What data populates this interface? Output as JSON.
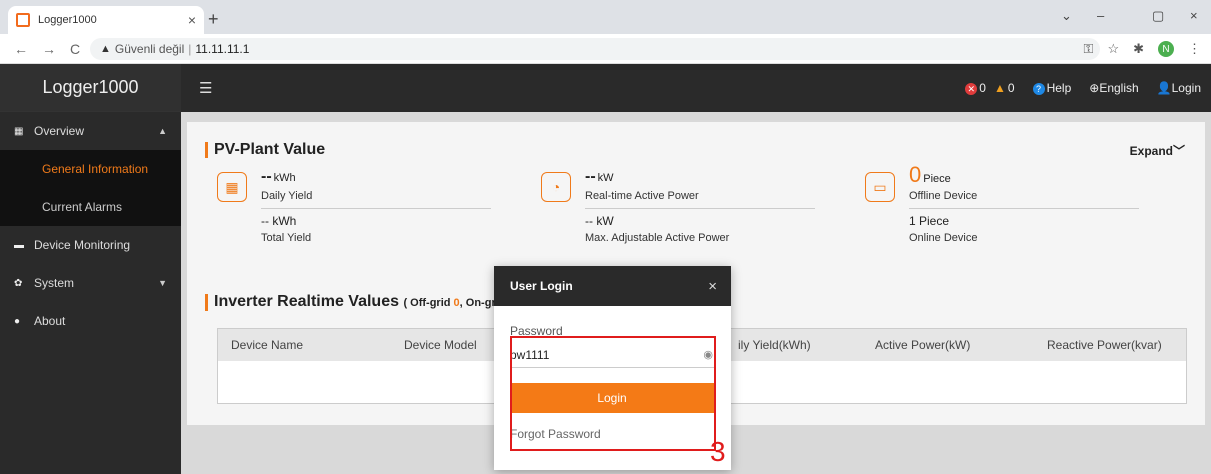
{
  "browser": {
    "tab_title": "Logger1000",
    "tab_close": "×",
    "new_tab": "+",
    "back": "←",
    "forward": "→",
    "reload": "C",
    "security_label": "Güvenli değil",
    "address": "11.11.11.1",
    "profile_initial": "N",
    "win_min": "–",
    "win_max": "▢",
    "win_close": "×",
    "tab_dropdown": "⌄"
  },
  "app": {
    "brand": "Logger1000",
    "header": {
      "error_count": "0",
      "warning_count": "0",
      "help": "Help",
      "language": "English",
      "login": "Login"
    },
    "sidebar": {
      "overview": "Overview",
      "general_information": "General Information",
      "current_alarms": "Current Alarms",
      "device_monitoring": "Device Monitoring",
      "system": "System",
      "about": "About"
    },
    "pv_plant": {
      "title": "PV-Plant Value",
      "expand": "Expand",
      "daily_yield_value": "--",
      "daily_yield_unit": "kWh",
      "daily_yield_label": "Daily Yield",
      "total_yield_value": "-- kWh",
      "total_yield_label": "Total Yield",
      "active_power_value": "--",
      "active_power_unit": "kW",
      "active_power_label": "Real-time Active Power",
      "max_power_value": "-- kW",
      "max_power_label": "Max. Adjustable Active Power",
      "offline_value": "0",
      "offline_unit": "Piece",
      "offline_label": "Offline Device",
      "online_value": "1 Piece",
      "online_label": "Online Device"
    },
    "inverter": {
      "title": "Inverter Realtime Values",
      "paren_open": "( Off-grid ",
      "offgrid_count": "0",
      "onclip": ", On-gr",
      "columns": [
        "Device Name",
        "Device Model",
        "ily Yield(kWh)",
        "Active Power(kW)",
        "Reactive Power(kvar)"
      ]
    }
  },
  "modal": {
    "title": "User Login",
    "close": "×",
    "password_label": "Password",
    "password_value": "pw1111",
    "login_button": "Login",
    "forgot_password": "Forgot Password"
  },
  "annotation": {
    "step": "3"
  }
}
